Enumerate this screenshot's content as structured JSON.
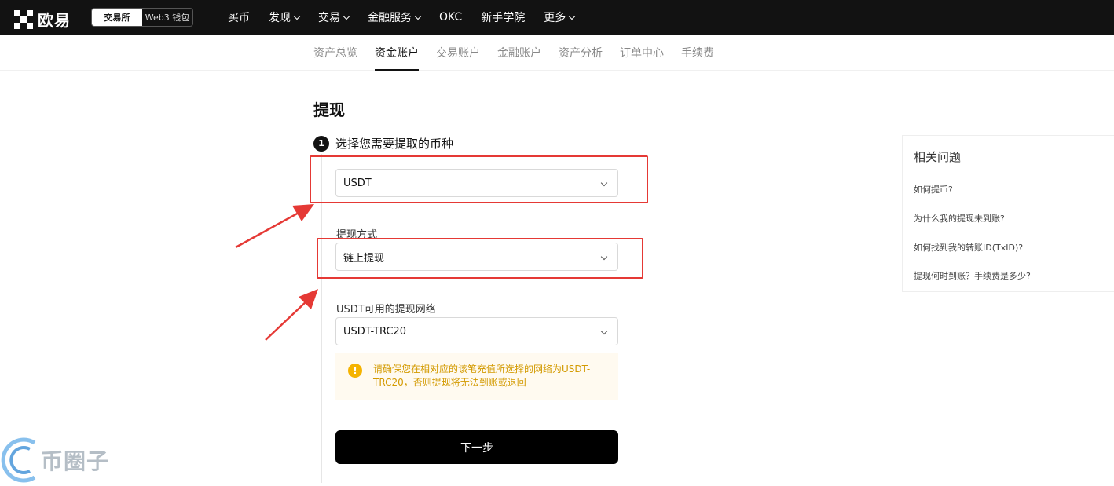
{
  "header": {
    "logo_text": "欧易",
    "switch": [
      {
        "label": "交易所",
        "active": true
      },
      {
        "label": "Web3 钱包",
        "active": false
      }
    ],
    "nav": [
      {
        "label": "买币",
        "dropdown": false
      },
      {
        "label": "发现",
        "dropdown": true
      },
      {
        "label": "交易",
        "dropdown": true
      },
      {
        "label": "金融服务",
        "dropdown": true
      },
      {
        "label": "OKC",
        "dropdown": false
      },
      {
        "label": "新手学院",
        "dropdown": false
      },
      {
        "label": "更多",
        "dropdown": true
      }
    ]
  },
  "subnav": [
    {
      "label": "资产总览",
      "active": false
    },
    {
      "label": "资金账户",
      "active": true
    },
    {
      "label": "交易账户",
      "active": false
    },
    {
      "label": "金融账户",
      "active": false
    },
    {
      "label": "资产分析",
      "active": false
    },
    {
      "label": "订单中心",
      "active": false
    },
    {
      "label": "手续费",
      "active": false
    }
  ],
  "page": {
    "title": "提现",
    "step": {
      "number": "1",
      "label": "选择您需要提取的币种"
    },
    "coin_select": {
      "value": "USDT"
    },
    "method": {
      "label": "提现方式",
      "value": "链上提现"
    },
    "network": {
      "label": "USDT可用的提现网络",
      "value": "USDT-TRC20"
    },
    "warning": {
      "icon": "!",
      "text": "请确保您在相对应的该笔充值所选择的网络为USDT-TRC20，否则提现将无法到账或退回"
    },
    "next_button": "下一步"
  },
  "faq": {
    "title": "相关问题",
    "items": [
      "如何提币?",
      "为什么我的提现未到账?",
      "如何找到我的转账ID(TxID)?",
      "提现何时到账？手续费是多少?"
    ]
  },
  "watermark": {
    "text": "币圈子"
  },
  "colors": {
    "topbar": "#121212",
    "annotation_red": "#e53935",
    "warning_text": "#d39a00",
    "warning_icon": "#f5b300",
    "button": "#000000"
  }
}
